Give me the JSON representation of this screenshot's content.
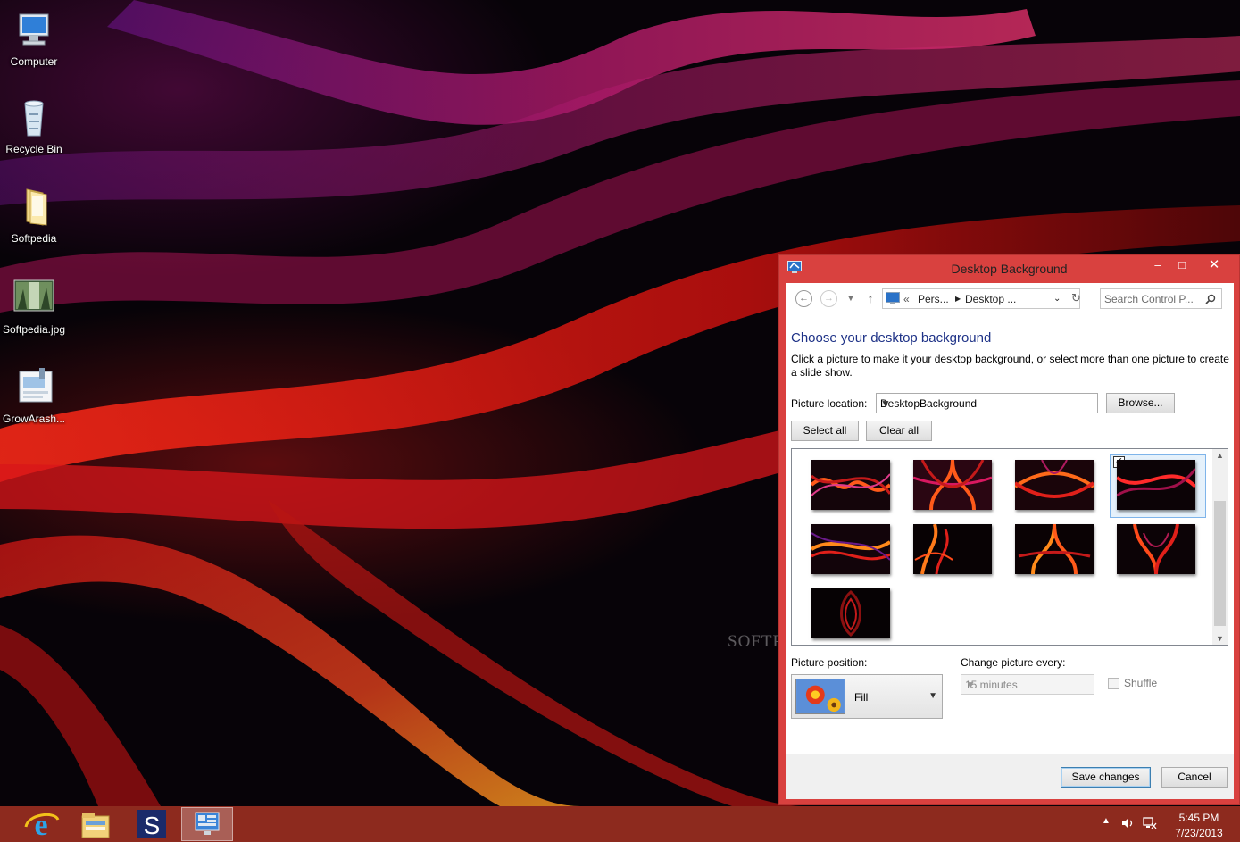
{
  "desktop": {
    "icons": [
      {
        "label": "Computer",
        "icon": "computer-icon"
      },
      {
        "label": "Recycle Bin",
        "icon": "recycle-bin-icon"
      },
      {
        "label": "Softpedia",
        "icon": "folder-icon"
      },
      {
        "label": "Softpedia.jpg",
        "icon": "image-file-icon"
      },
      {
        "label": "GrowArash...",
        "icon": "application-icon"
      }
    ],
    "watermark": "SOFTPEDIA"
  },
  "window": {
    "title": "Desktop Background",
    "controls": {
      "minimize": "–",
      "maximize": "□",
      "close": "✕"
    },
    "nav": {
      "back": "←",
      "forward": "→",
      "up": "↑",
      "breadcrumb_prefix": "«",
      "breadcrumb": [
        "Pers...",
        "Desktop ..."
      ],
      "search_placeholder": "Search Control P..."
    },
    "heading": "Choose your desktop background",
    "description": "Click a picture to make it your desktop background, or select more than one picture to create a slide show.",
    "picture_location_label": "Picture location:",
    "picture_location_value": "DesktopBackground",
    "browse_label": "Browse...",
    "select_all_label": "Select all",
    "clear_all_label": "Clear all",
    "thumbnails": [
      {
        "name": "wallpaper-1",
        "selected": false
      },
      {
        "name": "wallpaper-2",
        "selected": false
      },
      {
        "name": "wallpaper-3",
        "selected": false
      },
      {
        "name": "wallpaper-4",
        "selected": true
      },
      {
        "name": "wallpaper-5",
        "selected": false
      },
      {
        "name": "wallpaper-6",
        "selected": false
      },
      {
        "name": "wallpaper-7",
        "selected": false
      },
      {
        "name": "wallpaper-8",
        "selected": false
      },
      {
        "name": "wallpaper-9",
        "selected": false
      }
    ],
    "picture_position_label": "Picture position:",
    "picture_position_value": "Fill",
    "change_picture_label": "Change picture every:",
    "change_picture_value": "15 minutes",
    "shuffle_label": "Shuffle",
    "save_label": "Save changes",
    "cancel_label": "Cancel"
  },
  "taskbar": {
    "apps": [
      {
        "name": "internet-explorer-icon",
        "active": false
      },
      {
        "name": "file-explorer-icon",
        "active": false
      },
      {
        "name": "softpedia-app-icon",
        "label": "S",
        "active": false
      },
      {
        "name": "control-panel-icon",
        "active": true
      }
    ],
    "time": "5:45 PM",
    "date": "7/23/2013"
  },
  "colors": {
    "window_frame": "#d9413f",
    "taskbar": "#8d2a1e",
    "heading": "#1e3287"
  }
}
